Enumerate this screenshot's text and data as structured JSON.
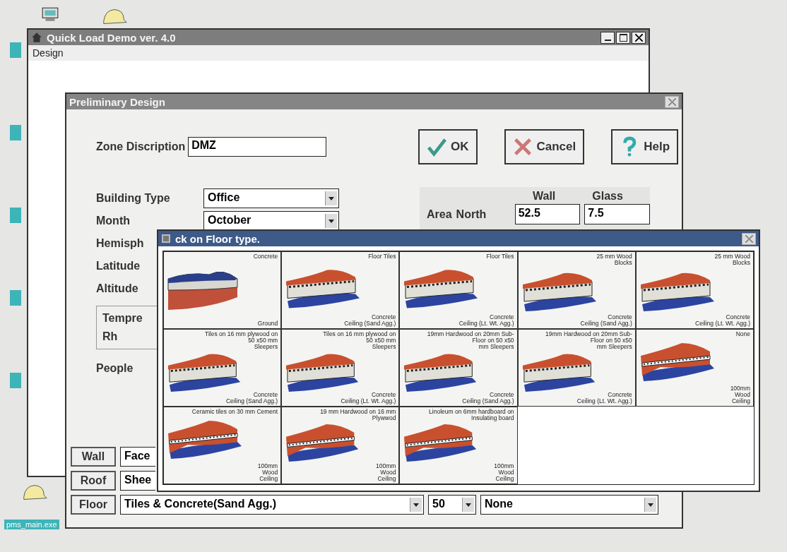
{
  "desktop": {
    "shortcut_label": "pms_main.exe"
  },
  "main_window": {
    "title": "Quick Load Demo ver. 4.0",
    "menu": [
      "Design"
    ]
  },
  "dialog": {
    "title": "Preliminary Design",
    "zone_label": "Zone Discription",
    "zone_value": "DMZ",
    "buttons": [
      {
        "kind": "ok",
        "label": "OK"
      },
      {
        "kind": "cancel",
        "label": "Cancel"
      },
      {
        "kind": "help",
        "label": "Help"
      }
    ],
    "fields": [
      {
        "label": "Building Type",
        "value": "Office"
      },
      {
        "label": "Month",
        "value": "October"
      }
    ],
    "more_labels": [
      "Hemisph",
      "Latitude",
      "Altitude"
    ],
    "climate_labels": [
      "Tempre",
      "Rh"
    ],
    "people_label": "People",
    "area": {
      "row_label": "Area",
      "columns": [
        "Wall",
        "Glass"
      ],
      "rows": [
        {
          "label": "North",
          "wall": "52.5",
          "glass": "7.5"
        }
      ]
    },
    "constructions": [
      {
        "label": "Wall",
        "value": "Face"
      },
      {
        "label": "Roof",
        "value": "Shee"
      },
      {
        "label": "Floor",
        "value": "Tiles & Concrete(Sand Agg.)",
        "thickness": "50",
        "finish": "None"
      }
    ]
  },
  "floor_picker": {
    "title": "ck on Floor type.",
    "options": [
      {
        "kind": "ground",
        "top": "Concrete",
        "bottom": [
          "Ground"
        ]
      },
      {
        "kind": "slab",
        "top": "Floor Tiles",
        "bottom": [
          "Concrete",
          "Ceiling (Sand Agg.)"
        ]
      },
      {
        "kind": "slab",
        "top": "Floor Tiles",
        "bottom": [
          "Concrete",
          "Ceiling (Lt. Wt. Agg.)"
        ]
      },
      {
        "kind": "slab",
        "top": "25 mm Wood Blocks",
        "bottom": [
          "Concrete",
          "Ceiling (Sand Agg.)"
        ]
      },
      {
        "kind": "slab",
        "top": "25 mm Wood Blocks",
        "bottom": [
          "Concrete",
          "Ceiling (Lt. Wt. Agg.)"
        ]
      },
      {
        "kind": "slab",
        "caption": "Tiles on 16 mm plywood on",
        "top": "50 x50 mm Sleepers",
        "bottom": [
          "Concrete",
          "Ceiling (Sand Agg.)"
        ]
      },
      {
        "kind": "slab",
        "caption": "Tiles on 16 mm plywood on",
        "top": "50 x50 mm Sleepers",
        "bottom": [
          "Concrete",
          "Ceiling (Lt. Wt. Agg.)"
        ]
      },
      {
        "kind": "slab",
        "caption": "19mm Hardwood on 20mm Sub-",
        "top": "Floor on 50 x50 mm Sleepers",
        "bottom": [
          "Concrete",
          "Ceiling (Sand Agg.)"
        ]
      },
      {
        "kind": "slab",
        "caption": "19mm Hardwood on 20mm Sub-",
        "top": "Floor on 50 x50 mm Sleepers",
        "bottom": [
          "Concrete",
          "Ceiling (Lt. Wt. Agg.)"
        ]
      },
      {
        "kind": "wood",
        "top": "None",
        "bottom": [
          "100mm",
          "Wood",
          "Ceiling"
        ]
      },
      {
        "kind": "wood",
        "caption": "Ceramic tiles on 30 mm Cement",
        "bottom": [
          "100mm",
          "Wood",
          "Ceiling"
        ]
      },
      {
        "kind": "wood",
        "caption": "19 mm Hardwood on 16 mm",
        "top": "Plywwod",
        "bottom": [
          "100mm",
          "Wood",
          "Ceiling"
        ]
      },
      {
        "kind": "wood",
        "caption": "Linoleum on 6mm hardboard on",
        "top": "Insulating board",
        "bottom": [
          "100mm",
          "Wood",
          "Ceiling"
        ]
      }
    ]
  }
}
